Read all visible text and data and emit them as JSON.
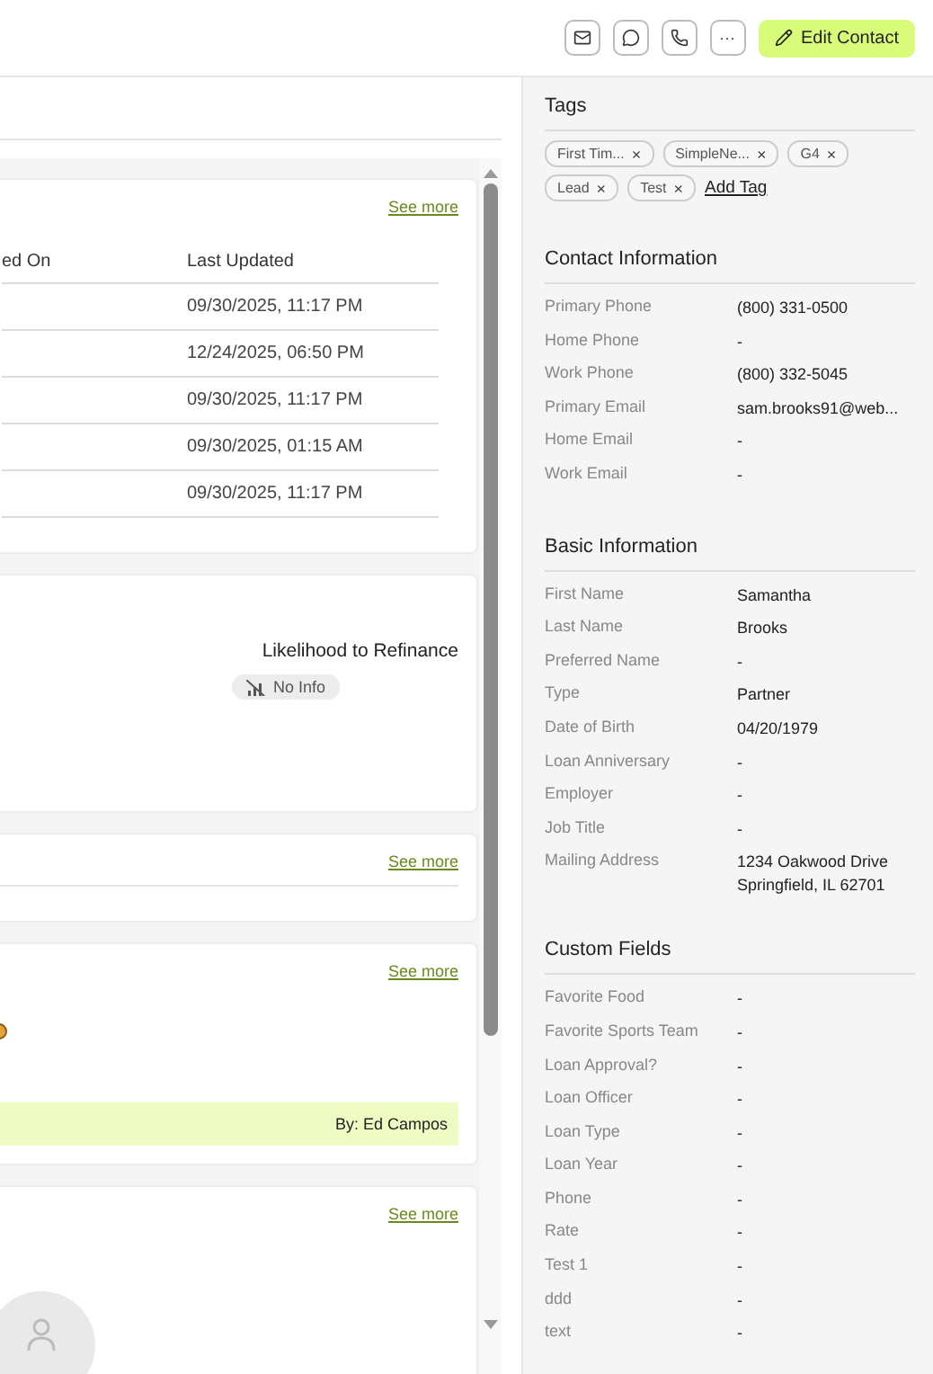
{
  "toolbar": {
    "actions": [
      {
        "kind": "mail"
      },
      {
        "kind": "chat"
      },
      {
        "kind": "phone"
      },
      {
        "kind": "more",
        "label": "···"
      }
    ],
    "edit_button": "Edit Contact"
  },
  "activity_table": {
    "link": "See more",
    "columns": [
      "ed On",
      "Last Updated"
    ],
    "rows": [
      "09/30/2025, 11:17 PM",
      "12/24/2025, 06:50 PM",
      "09/30/2025, 11:17 PM",
      "09/30/2025, 01:15 AM",
      "09/30/2025, 11:17 PM"
    ]
  },
  "refinance_card": {
    "label": "Likelihood to Refinance",
    "badge": "No Info"
  },
  "card_3": {
    "link": "See more"
  },
  "note_card": {
    "link": "See more",
    "author": "By: Ed Campos"
  },
  "card_5": {
    "link": "See more"
  },
  "sidebar": {
    "tags": {
      "title": "Tags",
      "items": [
        "First Tim...",
        "SimpleNe...",
        "G4",
        "Lead",
        "Test"
      ],
      "remove": "×",
      "add_label": "Add Tag"
    },
    "sections": [
      {
        "title": "Contact Information",
        "fields": [
          {
            "label": "Primary Phone",
            "value": "(800) 331-0500"
          },
          {
            "label": "Home Phone",
            "value": "-"
          },
          {
            "label": "Work Phone",
            "value": "(800) 332-5045"
          },
          {
            "label": "Primary Email",
            "value": "sam.brooks91@web..."
          },
          {
            "label": "Home Email",
            "value": "-"
          },
          {
            "label": "Work Email",
            "value": "-"
          }
        ]
      },
      {
        "title": "Basic Information",
        "fields": [
          {
            "label": "First Name",
            "value": "Samantha"
          },
          {
            "label": "Last Name",
            "value": "Brooks"
          },
          {
            "label": "Preferred Name",
            "value": "-"
          },
          {
            "label": "Type",
            "value": "Partner"
          },
          {
            "label": "Date of Birth",
            "value": "04/20/1979"
          },
          {
            "label": "Loan Anniversary",
            "value": "-"
          },
          {
            "label": "Employer",
            "value": "-"
          },
          {
            "label": "Job Title",
            "value": "-"
          },
          {
            "label": "Mailing Address",
            "value": "1234 Oakwood Drive\nSpringfield, IL 62701"
          }
        ]
      },
      {
        "title": "Custom Fields",
        "fields": [
          {
            "label": "Favorite Food",
            "value": "-"
          },
          {
            "label": "Favorite Sports Team",
            "value": "-"
          },
          {
            "label": "Loan Approval?",
            "value": "-"
          },
          {
            "label": "Loan Officer",
            "value": "-"
          },
          {
            "label": "Loan Type",
            "value": "-"
          },
          {
            "label": "Loan Year",
            "value": "-"
          },
          {
            "label": "Phone",
            "value": "-"
          },
          {
            "label": "Rate",
            "value": "-"
          },
          {
            "label": "Test 1",
            "value": "-"
          },
          {
            "label": "ddd",
            "value": "-"
          },
          {
            "label": "text",
            "value": "-"
          }
        ]
      }
    ]
  }
}
